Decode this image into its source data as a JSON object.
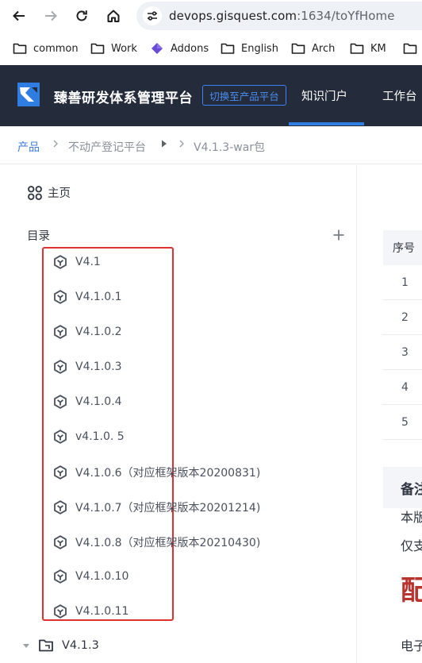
{
  "browser": {
    "url_host": "devops.gisquest.com",
    "url_rest": ":1634/toYfHome"
  },
  "bookmarks": [
    {
      "label": "common",
      "icon": "folder-icon"
    },
    {
      "label": "Work",
      "icon": "folder-icon"
    },
    {
      "label": "Addons",
      "icon": "addons-icon"
    },
    {
      "label": "English",
      "icon": "folder-icon"
    },
    {
      "label": "Arch",
      "icon": "folder-icon"
    },
    {
      "label": "KM",
      "icon": "folder-icon"
    }
  ],
  "header": {
    "title": "臻善研发体系管理平台",
    "switch_label": "切换至产品平台",
    "tabs": [
      "知识门户",
      "工作台"
    ],
    "active_tab": "知识门户"
  },
  "breadcrumb": {
    "items": [
      "产品",
      "不动产登记平台",
      "V4.1.3-war包"
    ]
  },
  "sidebar": {
    "home_label": "主页",
    "directory_label": "目录",
    "items": [
      "V4.1",
      "V4.1.0.1",
      "V4.1.0.2",
      "V4.1.0.3",
      "V4.1.0.4",
      "v4.1.0. 5",
      "V4.1.0.6（对应框架版本20200831)",
      "V4.1.0.7（对应框架版本20201214)",
      "V4.1.0.8（对应框架版本20210430)",
      "V4.1.0.10",
      "V4.1.0.11"
    ],
    "folder_label": "V4.1.3"
  },
  "main": {
    "table_header": "序号",
    "rows": [
      "1",
      "2",
      "3",
      "4",
      "5"
    ],
    "note_title": "备注",
    "text_line_1": "本版",
    "text_line_2": "仅支",
    "big_red_text": "配",
    "text_line_3": "电子"
  },
  "colors": {
    "header_bg": "#242b3a",
    "accent_blue": "#2f7de1",
    "highlight_red": "#e03131"
  }
}
